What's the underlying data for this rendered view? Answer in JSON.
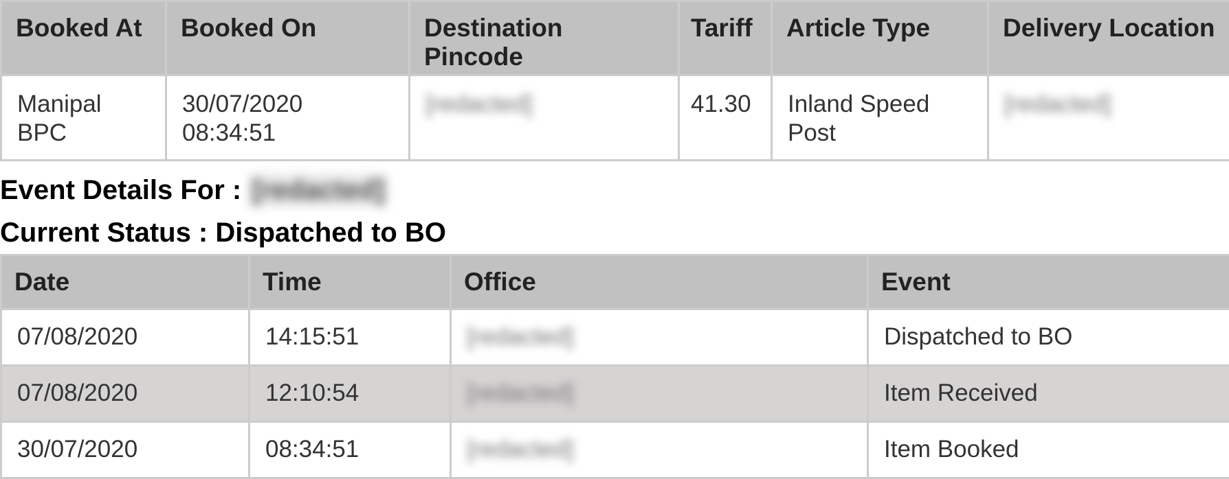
{
  "booking": {
    "headers": [
      "Booked At",
      "Booked On",
      "Destination Pincode",
      "Tariff",
      "Article Type",
      "Delivery Location"
    ],
    "row": {
      "booked_at": "Manipal BPC",
      "booked_on": "30/07/2020 08:34:51",
      "destination_pincode": "[redacted]",
      "tariff": "41.30",
      "article_type": "Inland Speed Post",
      "delivery_location": "[redacted]"
    }
  },
  "event_details": {
    "label": "Event Details For :",
    "tracking_id": "[redacted]"
  },
  "current_status": {
    "label": "Current Status : Dispatched to BO"
  },
  "events": {
    "headers": [
      "Date",
      "Time",
      "Office",
      "Event"
    ],
    "rows": [
      {
        "date": "07/08/2020",
        "time": "14:15:51",
        "office": "[redacted]",
        "event": "Dispatched to BO"
      },
      {
        "date": "07/08/2020",
        "time": "12:10:54",
        "office": "[redacted]",
        "event": "Item Received"
      },
      {
        "date": "30/07/2020",
        "time": "08:34:51",
        "office": "[redacted]",
        "event": "Item Booked"
      }
    ]
  },
  "colors": {
    "header_bg": "#c1c1c1",
    "border": "#cccccc",
    "alt_row_bg": "#d6d3d3",
    "text": "#333333",
    "heading_text": "#000000"
  }
}
